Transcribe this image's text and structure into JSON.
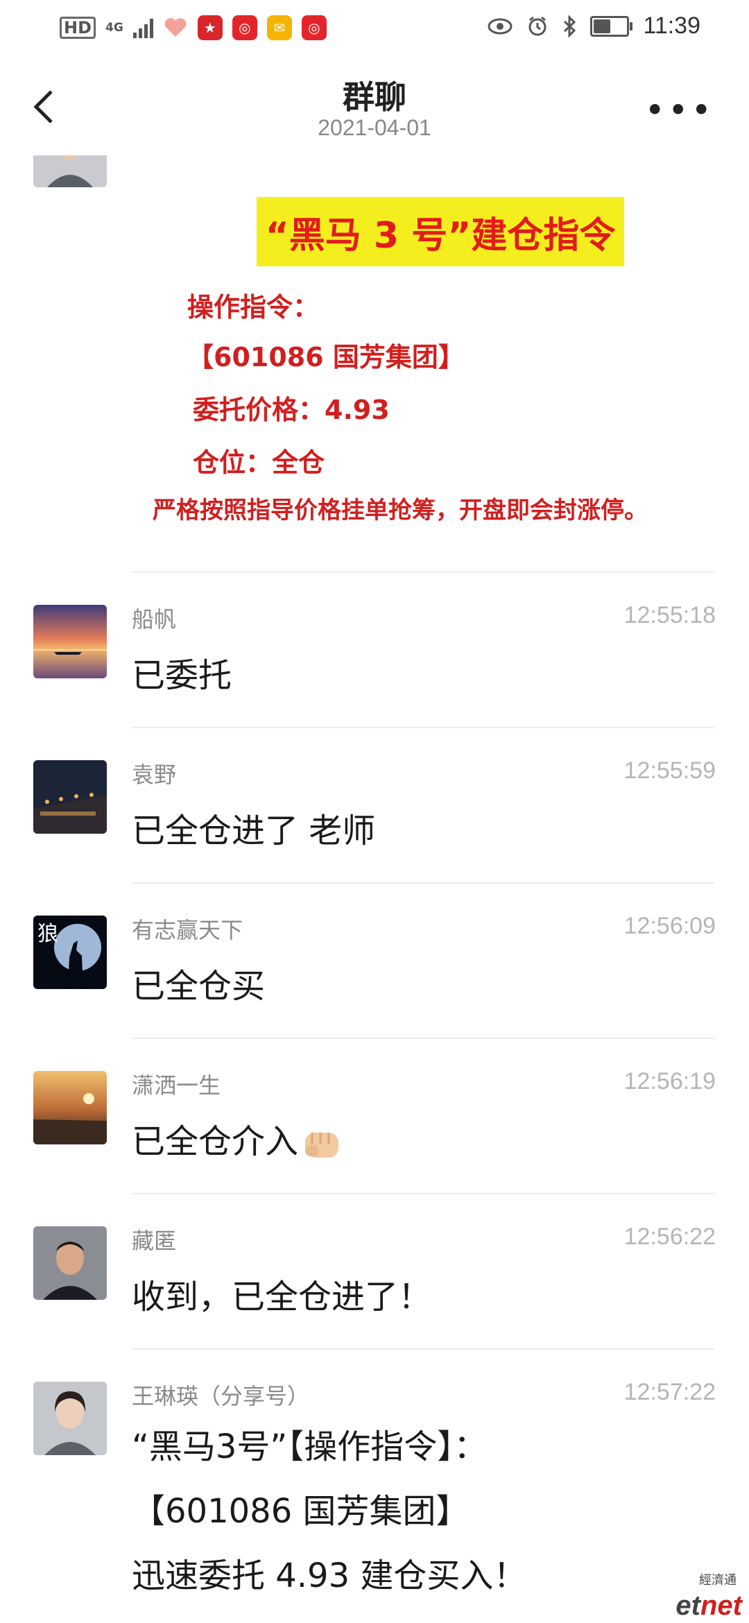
{
  "status_bar": {
    "hd": "HD",
    "network": "4G",
    "time": "11:39",
    "battery_level": 0.55,
    "icons": [
      "hd-icon",
      "signal-icon",
      "health-icon",
      "app-icon",
      "app-icon",
      "mail-icon",
      "app-icon",
      "eye-icon",
      "alarm-icon",
      "bluetooth-icon",
      "battery-icon"
    ]
  },
  "header": {
    "title": "群聊",
    "date": "2021-04-01",
    "more": "•••"
  },
  "notice": {
    "heading": "“黑马 3 号”建仓指令",
    "lines": [
      "操作指令：",
      "【601086  国芳集团】",
      "委托价格：4.93",
      "仓位：全仓",
      "严格按照指导价格挂单抢筹，开盘即会封涨停。"
    ]
  },
  "messages": [
    {
      "sender": "船帆",
      "time": "12:55:18",
      "text": "已委托"
    },
    {
      "sender": "袁野",
      "time": "12:55:59",
      "text": "已全仓进了 老师"
    },
    {
      "sender": "有志赢天下",
      "time": "12:56:09",
      "text": "已全仓买"
    },
    {
      "sender": "潇洒一生",
      "time": "12:56:19",
      "text": "已全仓介入"
    },
    {
      "sender": "藏匿",
      "time": "12:56:22",
      "text": "收到，已全仓进了！"
    },
    {
      "sender": "王琳瑛（分享号）",
      "time": "12:57:22",
      "lines": [
        "“黑马3号”【操作指令】：",
        " 【601086 国芳集团】",
        "迅速委托 4.93 建仓买入！"
      ]
    }
  ],
  "avatars": {
    "wolf_glyph": "狼"
  },
  "watermark": {
    "cn": "經濟通",
    "en_left": "et",
    "en_right": "net"
  }
}
